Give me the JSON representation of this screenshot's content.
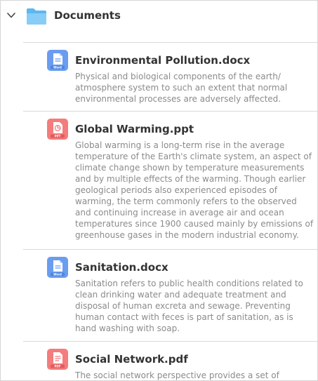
{
  "folder": {
    "name": "Documents",
    "expanded": true,
    "icon": "folder-icon",
    "color": "#5cb7f2"
  },
  "files": [
    {
      "name": "Environmental Pollution.docx",
      "type_badge": "Word",
      "icon": "word-file-icon",
      "description": "Physical and biological components of the earth/ atmosphere system to such an extent that normal environmental processes are adversely affected."
    },
    {
      "name": "Global Warming.ppt",
      "type_badge": "PPT",
      "icon": "powerpoint-file-icon",
      "description": "Global warming is a long-term rise in the average temperature of the Earth's climate system, an aspect of climate change shown by temperature measurements and by multiple effects of the warming. Though earlier geological periods also experienced episodes of warming, the term commonly refers to the observed and continuing increase in average air and ocean temperatures since 1900 caused mainly by emissions of greenhouse gases in the modern industrial economy."
    },
    {
      "name": "Sanitation.docx",
      "type_badge": "Word",
      "icon": "word-file-icon",
      "description": "Sanitation refers to public health conditions related to clean drinking water and adequate treatment and disposal of human excreta and sewage. Preventing human contact with feces is part of sanitation, as is hand washing with soap."
    },
    {
      "name": "Social Network.pdf",
      "type_badge": "PDF",
      "icon": "pdf-file-icon",
      "description": "The social network perspective provides a set of"
    }
  ],
  "colors": {
    "word": "#6a9df0",
    "ppt": "#f47c7c",
    "pdf": "#f47c7c",
    "title": "#333333",
    "description": "#8b8b8b"
  }
}
